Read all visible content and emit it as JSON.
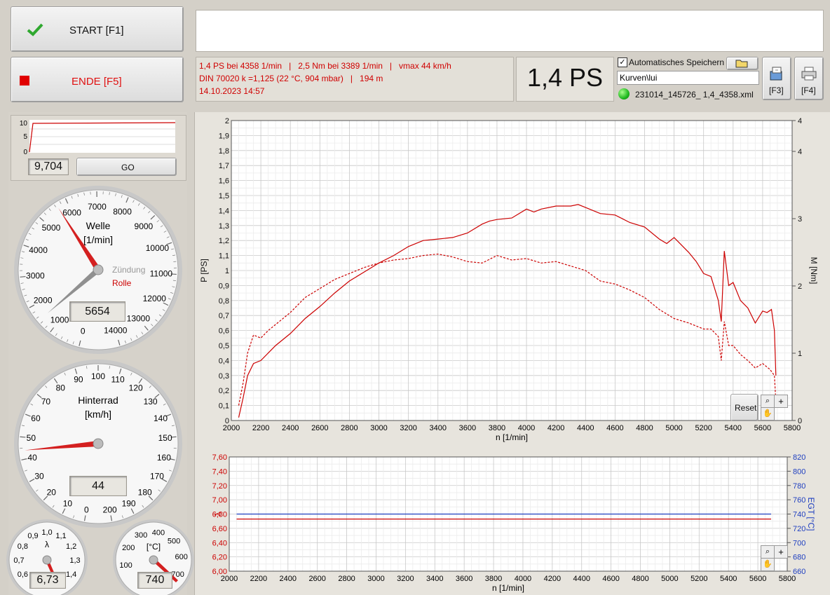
{
  "buttons": {
    "start": "START [F1]",
    "end": "ENDE [F5]",
    "f3": "[F3]",
    "f4": "[F4]",
    "go": "GO",
    "reset": "Reset"
  },
  "info": {
    "line1": "1,4 PS bei 4358 1/min   |   2,5 Nm bei 3389 1/min   |   vmax 44 km/h",
    "line2": "DIN 70020 k =1,125 (22 °C, 904 mbar)   |   194 m",
    "line3": "14.10.2023 14:57"
  },
  "power_display": "1,4 PS",
  "autosave": {
    "label": "Automatisches Speichern",
    "checked": true,
    "path": "Kurven\\lui",
    "filename": "231014_145726_ 1,4_4358.xml"
  },
  "mini_chart": {
    "value": "9,704",
    "y_ticks": [
      "10",
      "5",
      "0"
    ]
  },
  "gauge_rpm": {
    "title": "Welle",
    "unit": "[1/min]",
    "label_ignition": "Zündung",
    "label_roller": "Rolle",
    "value": "5654",
    "ticks": [
      "0",
      "1000",
      "2000",
      "3000",
      "4000",
      "5000",
      "6000",
      "7000",
      "8000",
      "9000",
      "10000",
      "11000",
      "12000",
      "13000",
      "14000"
    ],
    "needle_roller": 5654,
    "needle_ignition": 1500,
    "max": 14000
  },
  "gauge_speed": {
    "title": "Hinterrad",
    "unit": "[km/h]",
    "value": "44",
    "ticks": [
      "0",
      "10",
      "20",
      "30",
      "40",
      "50",
      "60",
      "70",
      "80",
      "90",
      "100",
      "110",
      "120",
      "130",
      "140",
      "150",
      "160",
      "170",
      "180",
      "190",
      "200"
    ],
    "needle": 44,
    "max": 200
  },
  "gauge_lambda": {
    "symbol": "λ",
    "value": "6,73",
    "ticks": [
      "0,6",
      "0,7",
      "0,8",
      "0,9",
      "1,0",
      "1,1",
      "1,2",
      "1,3",
      "1,4"
    ]
  },
  "gauge_egt": {
    "unit": "[°C]",
    "value": "740",
    "ticks": [
      "100",
      "200",
      "300",
      "400",
      "500",
      "600",
      "700"
    ]
  },
  "colors": {
    "power": "#cc0000",
    "egt": "#1f3fc0",
    "grid": "#d2d2d2"
  },
  "chart_data": [
    {
      "type": "line",
      "xlabel": "n [1/min]",
      "ylabel": "P [PS]",
      "y2label": "M [Nm]",
      "xlim": [
        2000,
        5800
      ],
      "ylim": [
        0,
        2
      ],
      "y2lim": [
        0,
        4
      ],
      "x_ticks": [
        "2000",
        "2200",
        "2400",
        "2600",
        "2800",
        "3000",
        "3200",
        "3400",
        "3600",
        "3800",
        "4000",
        "4200",
        "4400",
        "4600",
        "4800",
        "5000",
        "5200",
        "5400",
        "5600",
        "5800"
      ],
      "y_ticks": [
        "0",
        "0,1",
        "0,2",
        "0,3",
        "0,4",
        "0,5",
        "0,6",
        "0,7",
        "0,8",
        "0,9",
        "1",
        "1,1",
        "1,2",
        "1,3",
        "1,4",
        "1,5",
        "1,6",
        "1,7",
        "1,8",
        "1,9",
        "2"
      ],
      "y2_ticks": [
        "0",
        "1",
        "2",
        "3",
        "4",
        "4"
      ],
      "series": [
        {
          "axis": "left",
          "style": "solid",
          "x": [
            2050,
            2080,
            2110,
            2150,
            2200,
            2250,
            2300,
            2400,
            2500,
            2600,
            2700,
            2800,
            2900,
            3000,
            3100,
            3200,
            3300,
            3400,
            3500,
            3600,
            3700,
            3750,
            3800,
            3900,
            4000,
            4050,
            4100,
            4200,
            4300,
            4350,
            4400,
            4500,
            4600,
            4700,
            4800,
            4900,
            4950,
            5000,
            5100,
            5150,
            5200,
            5250,
            5300,
            5320,
            5340,
            5370,
            5400,
            5450,
            5500,
            5550,
            5600,
            5630,
            5660,
            5680,
            5690
          ],
          "values": [
            0.02,
            0.15,
            0.3,
            0.38,
            0.4,
            0.45,
            0.5,
            0.58,
            0.68,
            0.76,
            0.85,
            0.93,
            0.99,
            1.05,
            1.1,
            1.16,
            1.2,
            1.21,
            1.22,
            1.25,
            1.31,
            1.33,
            1.34,
            1.35,
            1.41,
            1.39,
            1.41,
            1.43,
            1.43,
            1.44,
            1.42,
            1.38,
            1.37,
            1.32,
            1.29,
            1.21,
            1.18,
            1.22,
            1.12,
            1.06,
            0.98,
            0.96,
            0.8,
            0.66,
            1.13,
            0.9,
            0.92,
            0.8,
            0.75,
            0.65,
            0.73,
            0.72,
            0.74,
            0.6,
            0.3
          ]
        },
        {
          "axis": "left",
          "style": "dashed",
          "x": [
            2050,
            2080,
            2110,
            2150,
            2200,
            2250,
            2300,
            2400,
            2500,
            2600,
            2700,
            2800,
            2900,
            3000,
            3100,
            3200,
            3300,
            3400,
            3500,
            3600,
            3700,
            3800,
            3900,
            4000,
            4100,
            4200,
            4300,
            4400,
            4500,
            4600,
            4700,
            4800,
            4900,
            5000,
            5100,
            5200,
            5250,
            5300,
            5320,
            5340,
            5370,
            5400,
            5450,
            5500,
            5550,
            5600,
            5650,
            5680,
            5690
          ],
          "values": [
            0.1,
            0.25,
            0.45,
            0.57,
            0.55,
            0.6,
            0.64,
            0.72,
            0.82,
            0.88,
            0.94,
            0.98,
            1.02,
            1.05,
            1.07,
            1.08,
            1.1,
            1.11,
            1.09,
            1.06,
            1.05,
            1.1,
            1.07,
            1.08,
            1.05,
            1.06,
            1.03,
            1.0,
            0.93,
            0.91,
            0.87,
            0.82,
            0.74,
            0.68,
            0.65,
            0.61,
            0.61,
            0.56,
            0.4,
            0.66,
            0.5,
            0.5,
            0.44,
            0.4,
            0.35,
            0.38,
            0.34,
            0.3,
            0.12
          ]
        }
      ]
    },
    {
      "type": "line",
      "xlabel": "n [1/min]",
      "ylabel": "λ",
      "y2label": "EGT [°C]",
      "xlim": [
        2000,
        5800
      ],
      "ylim": [
        6.0,
        7.6
      ],
      "y2lim": [
        660,
        820
      ],
      "x_ticks": [
        "2000",
        "2200",
        "2400",
        "2600",
        "2800",
        "3000",
        "3200",
        "3400",
        "3600",
        "3800",
        "4000",
        "4200",
        "4400",
        "4600",
        "4800",
        "5000",
        "5200",
        "5400",
        "5600",
        "5800"
      ],
      "y_ticks": [
        "6,00",
        "6,20",
        "6,40",
        "6,60",
        "6,80",
        "7,00",
        "7,20",
        "7,40",
        "7,60"
      ],
      "y2_ticks": [
        "660",
        "680",
        "700",
        "720",
        "740",
        "760",
        "780",
        "800",
        "820"
      ],
      "series": [
        {
          "axis": "left",
          "x": [
            2050,
            5690
          ],
          "values": [
            6.73,
            6.73
          ]
        },
        {
          "axis": "right",
          "x": [
            2050,
            5690
          ],
          "values": [
            740,
            740
          ]
        }
      ]
    }
  ]
}
